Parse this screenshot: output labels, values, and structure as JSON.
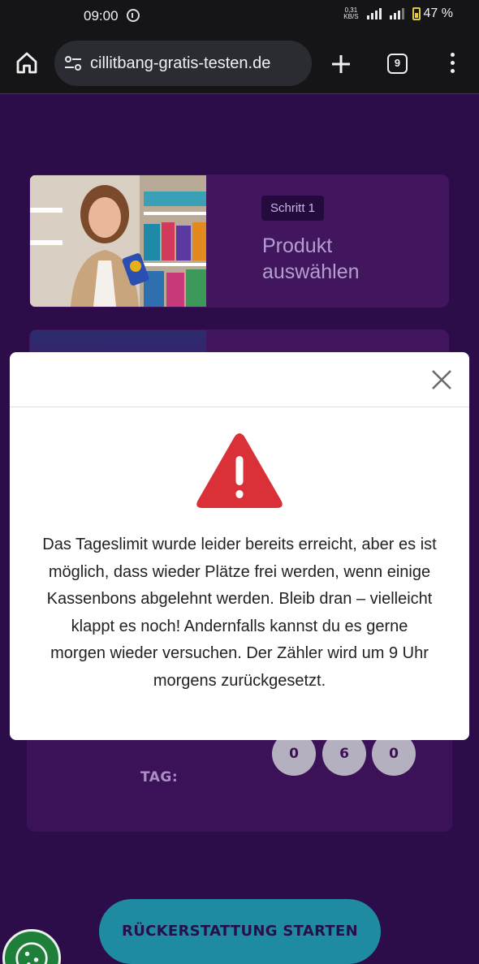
{
  "status_bar": {
    "time": "09:00",
    "network_speed_value": "0,31",
    "network_speed_unit": "KB/S",
    "battery": "47 %"
  },
  "browser": {
    "url": "cillitbang-gratis-testen.de",
    "tab_count": "9"
  },
  "step_card": {
    "badge": "Schritt 1",
    "title": "Produkt auswählen"
  },
  "counter": {
    "label": "TAG:",
    "digits": [
      "0",
      "6",
      "0"
    ]
  },
  "cta": {
    "label": "RÜCKERSTATTUNG STARTEN"
  },
  "modal": {
    "message": "Das Tageslimit wurde leider bereits erreicht, aber es ist möglich, dass wieder Plätze frei werden, wenn einige Kassenbons abgelehnt werden. Bleib dran – vielleicht klappt es noch! Andernfalls kannst du es gerne morgen wieder versuchen. Der Zähler wird um 9 Uhr morgens zurückgesetzt."
  },
  "colors": {
    "page_background": "#2c0c49",
    "card_background": "#42165f",
    "warning_red": "#d93137",
    "cta_teal": "#1e8ba2",
    "cookie_green": "#1e7f3a"
  },
  "icons": {
    "home": "home-icon",
    "site_settings": "tune-icon",
    "new_tab": "plus-icon",
    "tab_switcher": "tabs-icon",
    "menu": "more-vertical-icon",
    "close": "close-icon",
    "warning": "warning-triangle-icon",
    "cookie": "cookie-icon"
  }
}
